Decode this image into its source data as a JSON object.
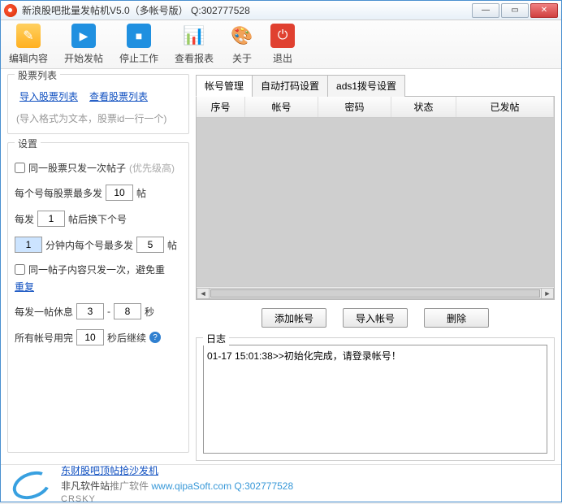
{
  "title": "新浪股吧批量发帖机V5.0（多帐号版） Q:302777528",
  "toolbar": {
    "edit": "编辑内容",
    "start": "开始发帖",
    "stop": "停止工作",
    "report": "查看报表",
    "about": "关于",
    "exit": "退出"
  },
  "left": {
    "stock_list_title": "股票列表",
    "import_link": "导入股票列表",
    "view_link": "查看股票列表",
    "import_hint": "(导入格式为文本，股票id一行一个)",
    "settings_title": "设置",
    "chk_one_post": "同一股票只发一次帖子",
    "chk_one_post_suffix": "(优先级高)",
    "row_max_prefix": "每个号每股票最多发",
    "row_max_val": "10",
    "row_max_suffix": "帖",
    "row_switch_prefix": "每发",
    "row_switch_val": "1",
    "row_switch_suffix": "帖后换下个号",
    "row_minute_val": "1",
    "row_minute_mid": "分钟内每个号最多发",
    "row_minute_val2": "5",
    "row_minute_suffix": "帖",
    "chk_dup_prefix": "同一帖子内容只发一次，避免重",
    "chk_dup_link": "重复",
    "row_rest_prefix": "每发一帖休息",
    "row_rest_lo": "3",
    "row_rest_sep": "-",
    "row_rest_hi": "8",
    "row_rest_suffix": "秒",
    "row_allused_prefix": "所有帐号用完",
    "row_allused_val": "10",
    "row_allused_suffix": "秒后继续"
  },
  "tabs": {
    "t1": "帐号管理",
    "t2": "自动打码设置",
    "t3": "ads1拨号设置"
  },
  "table": {
    "cols": [
      "序号",
      "帐号",
      "密码",
      "状态",
      "已发帖"
    ]
  },
  "buttons": {
    "add": "添加帐号",
    "import": "导入帐号",
    "delete": "删除"
  },
  "log": {
    "title": "日志",
    "line1": "01-17 15:01:38>>初始化完成，请登录帐号！"
  },
  "footer": {
    "link": "东财股吧顶帖抢沙发机",
    "brand": "非凡软件站",
    "brand_sub": "推广软件",
    "crsky": "CRSKY",
    "contact": "www.qipaSoft.com Q:302777528"
  }
}
